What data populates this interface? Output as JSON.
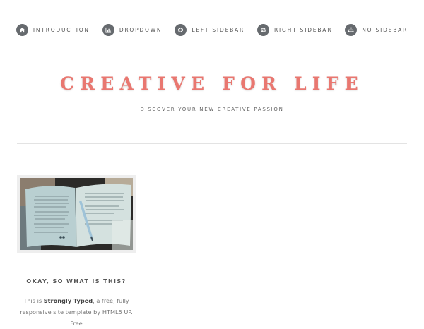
{
  "nav": {
    "items": [
      {
        "label": "INTRODUCTION",
        "icon": "home-icon"
      },
      {
        "label": "DROPDOWN",
        "icon": "bar-chart-icon"
      },
      {
        "label": "LEFT SIDEBAR",
        "icon": "gear-icon"
      },
      {
        "label": "RIGHT SIDEBAR",
        "icon": "retweet-icon"
      },
      {
        "label": "NO SIDEBAR",
        "icon": "sitemap-icon"
      }
    ]
  },
  "header": {
    "title": "CREATIVE FOR LIFE",
    "tagline": "DISCOVER YOUR NEW CREATIVE PASSION"
  },
  "intro_section": {
    "heading": "OKAY, SO WHAT IS THIS?",
    "text_this_is": "This is ",
    "name": "Strongly Typed",
    "text_mid": ", a free, fully responsive site template by ",
    "author_link": "HTML5 UP",
    "text_end": ". Free"
  },
  "colors": {
    "title": "#e97770",
    "icon_bg": "#666a6e"
  }
}
